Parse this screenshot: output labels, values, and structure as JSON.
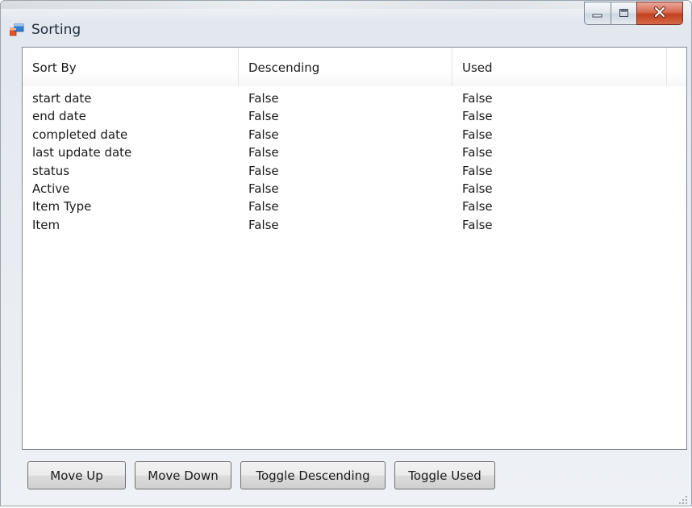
{
  "window": {
    "title": "Sorting",
    "icon": "windows-form-icon"
  },
  "caption_buttons": {
    "minimize_icon": "minimize-icon",
    "maximize_icon": "maximize-icon",
    "close_icon": "close-icon"
  },
  "list": {
    "columns": [
      "Sort By",
      "Descending",
      "Used"
    ],
    "rows": [
      [
        "start date",
        "False",
        "False"
      ],
      [
        "end date",
        "False",
        "False"
      ],
      [
        "completed date",
        "False",
        "False"
      ],
      [
        "last update date",
        "False",
        "False"
      ],
      [
        "status",
        "False",
        "False"
      ],
      [
        "Active",
        "False",
        "False"
      ],
      [
        "Item Type",
        "False",
        "False"
      ],
      [
        "Item",
        "False",
        "False"
      ]
    ]
  },
  "buttons": {
    "move_up": "Move Up",
    "move_down": "Move Down",
    "toggle_descending": "Toggle Descending",
    "toggle_used": "Toggle Used"
  },
  "colors": {
    "close_button": "#c2401f",
    "list_border": "#828790"
  }
}
